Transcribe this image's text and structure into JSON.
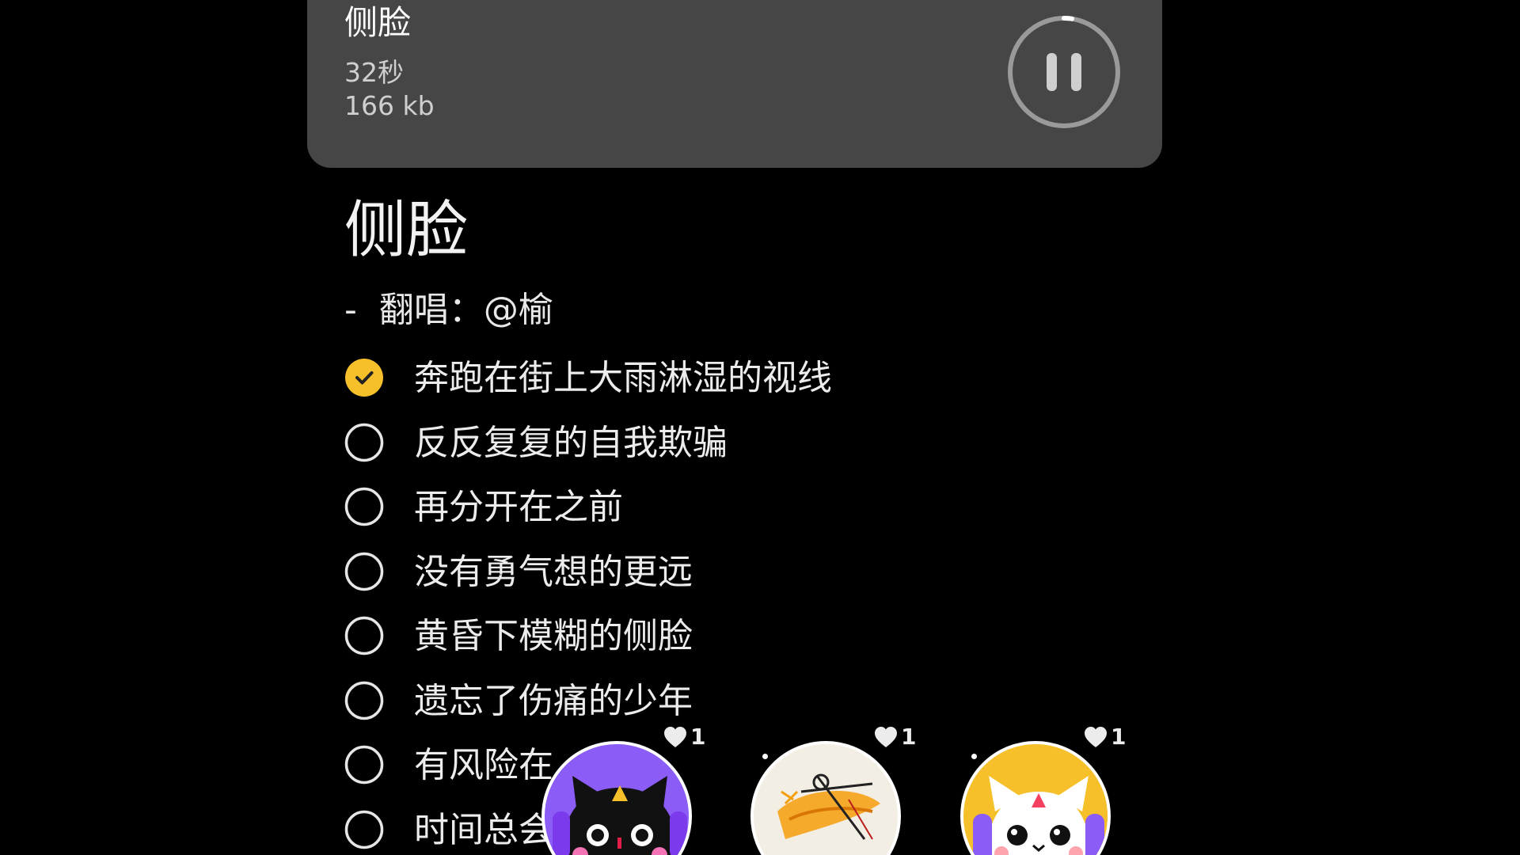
{
  "audio": {
    "title": "侧脸",
    "duration": "32秒",
    "size": "166 kb",
    "control_icon": "pause-icon"
  },
  "note": {
    "title": "侧脸",
    "subtitle": "-  翻唱：@榆",
    "items": [
      {
        "text": "奔跑在街上大雨淋湿的视线",
        "checked": true
      },
      {
        "text": "反反复复的自我欺骗",
        "checked": false
      },
      {
        "text": "再分开在之前",
        "checked": false
      },
      {
        "text": "没有勇气想的更远",
        "checked": false
      },
      {
        "text": "黄昏下模糊的侧脸",
        "checked": false
      },
      {
        "text": "遗忘了伤痛的少年",
        "checked": false
      },
      {
        "text": "有风险在",
        "checked": false
      },
      {
        "text": "时间总会",
        "checked": false
      }
    ]
  },
  "reactions": [
    {
      "likes": "1",
      "icon": "heart-icon",
      "avatar": "black-cat-headphones-avatar"
    },
    {
      "likes": "1",
      "icon": "heart-icon",
      "avatar": "hand-drawn-sketch-avatar"
    },
    {
      "likes": "1",
      "icon": "heart-icon",
      "avatar": "white-cat-headphones-avatar"
    }
  ],
  "colors": {
    "background": "#000000",
    "card": "#464646",
    "checked": "#f6c02a",
    "text": "#ececec"
  }
}
